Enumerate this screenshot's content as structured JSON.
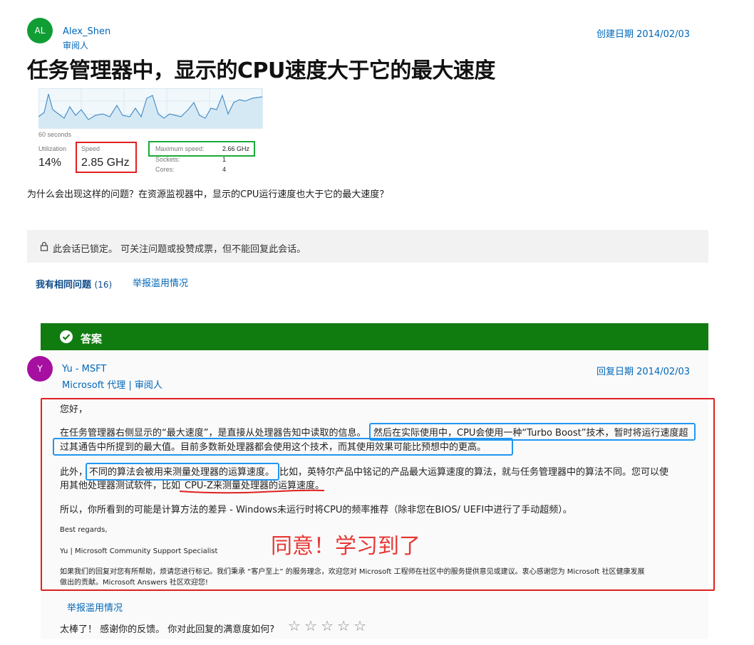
{
  "question": {
    "avatar_initials": "AL",
    "author_name": "Alex_Shen",
    "author_role": "审阅人",
    "created_label": "创建日期 2014/02/03",
    "title": "任务管理器中，显示的CPU速度大于它的最大速度",
    "body": "为什么会出现这样的问题？在资源监视器中，显示的CPU运行速度也大于它的最大速度？"
  },
  "screenshot": {
    "time_label": "60 seconds",
    "utilization_label": "Utilization",
    "utilization_value": "14%",
    "speed_label": "Speed",
    "speed_value": "2.85 GHz",
    "max_speed_label": "Maximum speed:",
    "max_speed_value": "2.66 GHz",
    "sockets_label": "Sockets:",
    "sockets_value": "1",
    "cores_label": "Cores:",
    "cores_value": "4"
  },
  "locked": {
    "icon": "lock-icon",
    "text": "此会话已锁定。 可关注问题或投赞成票，但不能回复此会话。"
  },
  "actions": {
    "same_question_label": "我有相同问题",
    "same_question_count": "(16)",
    "report_label": "举报滥用情况"
  },
  "answer": {
    "header_label": "答案",
    "avatar_initials": "Y",
    "author_name": "Yu - MSFT",
    "author_roles": "Microsoft 代理 | 审阅人",
    "reply_date_label": "回复日期 2014/02/03",
    "greeting": "您好，",
    "p1_a": "在任务管理器右侧显示的“最大速度”，是直接从处理器告知中读取的信息。",
    "p1_b": "然后在实际使用中，CPU会使用一种“Turbo Boost”技术，暂时将运行速度超",
    "p1_c": "过其通告中所提到的最大值。目前多数新处理器都会使用这个技术，而其使用效果可能比预想中的更高。",
    "p2_a": "此外，",
    "p2_b": "不同的算法会被用来测量处理器的运算速度。",
    "p2_c": "比如，英特尔产品中铭记的产品最大运算速度的算法，就与任务管理器中的算法不同。您可以使",
    "p2_d": "用其他处理器测试软件，比如",
    "p2_e": "CPU-Z来测量处理器的运算速度。",
    "p3": "所以，你所看到的可能是计算方法的差异 - Windows未运行时将CPU的频率推荐（除非您在BIOS/ UEFI中进行了手动超频）。",
    "regards": "Best regards,",
    "signature": "Yu | Microsoft Community Support Specialist",
    "footer_note_1": "如果我们的回复对您有所帮助，烦请您进行标记。我们秉承 “客户至上” 的服务理念，欢迎您对 Microsoft 工程师在社区中的服务提供意见或建议。衷心感谢您为 Microsoft 社区健康发展",
    "footer_note_2": "做出的贡献。Microsoft Answers 社区欢迎您!",
    "annotation": "同意！学习到了",
    "report_label": "举报滥用情况",
    "feedback_text": "太棒了！ 感谢你的反馈。 你对此回复的满意度如何?",
    "stars": [
      "☆",
      "☆",
      "☆",
      "☆",
      "☆"
    ]
  },
  "colors": {
    "link": "#0067b8",
    "answer_green": "#107c10",
    "highlight_red": "#e02020",
    "highlight_blue": "#2196f3",
    "highlight_green": "#1aaa3a",
    "annotation_red": "#e53935"
  }
}
